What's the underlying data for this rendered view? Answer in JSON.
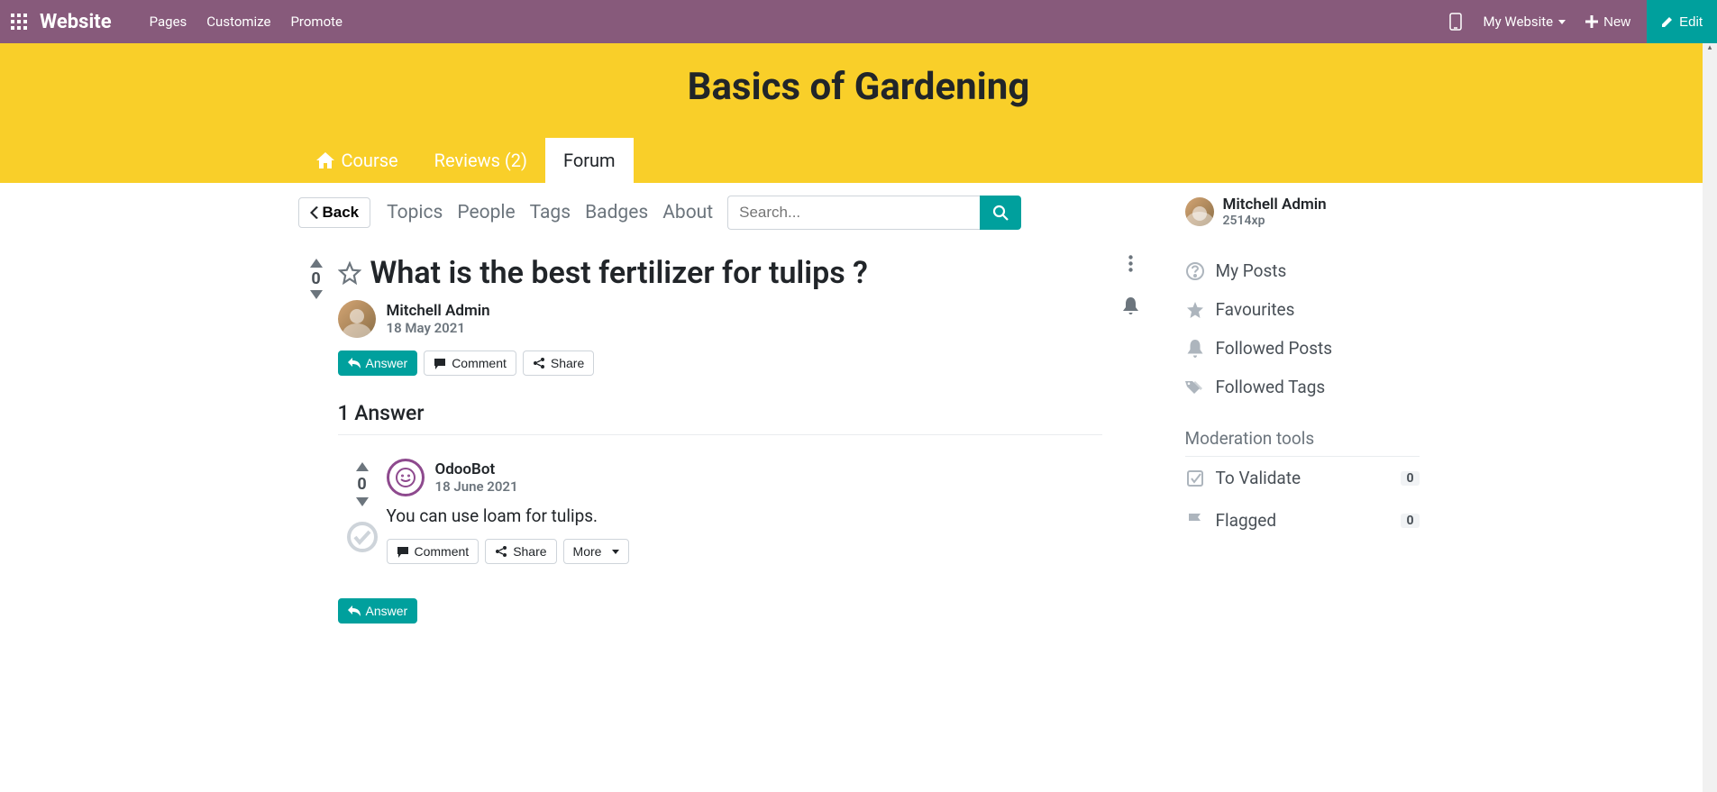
{
  "topbar": {
    "brand": "Website",
    "pages": "Pages",
    "customize": "Customize",
    "promote": "Promote",
    "my_website": "My Website",
    "new": "New",
    "edit": "Edit"
  },
  "banner": {
    "title": "Basics of Gardening",
    "tab_course": "Course",
    "tab_reviews": "Reviews (2)",
    "tab_forum": "Forum"
  },
  "subnav": {
    "back": "Back",
    "topics": "Topics",
    "people": "People",
    "tags": "Tags",
    "badges": "Badges",
    "about": "About"
  },
  "search": {
    "placeholder": "Search..."
  },
  "question": {
    "vote_count": "0",
    "title": "What is the best fertilizer for tulips ?",
    "author_name": "Mitchell Admin",
    "author_date": "18 May 2021",
    "btn_answer": "Answer",
    "btn_comment": "Comment",
    "btn_share": "Share",
    "answers_heading": "1 Answer"
  },
  "answer": {
    "vote_count": "0",
    "author_name": "OdooBot",
    "author_date": "18 June 2021",
    "text": "You can use loam for tulips.",
    "btn_comment": "Comment",
    "btn_share": "Share",
    "btn_more": "More",
    "btn_answer_bottom": "Answer"
  },
  "sidebar": {
    "profile_name": "Mitchell Admin",
    "profile_xp": "2514xp",
    "my_posts": "My Posts",
    "favourites": "Favourites",
    "followed_posts": "Followed Posts",
    "followed_tags": "Followed Tags",
    "mod_heading": "Moderation tools",
    "to_validate": "To Validate",
    "to_validate_count": "0",
    "flagged": "Flagged",
    "flagged_count": "0"
  }
}
